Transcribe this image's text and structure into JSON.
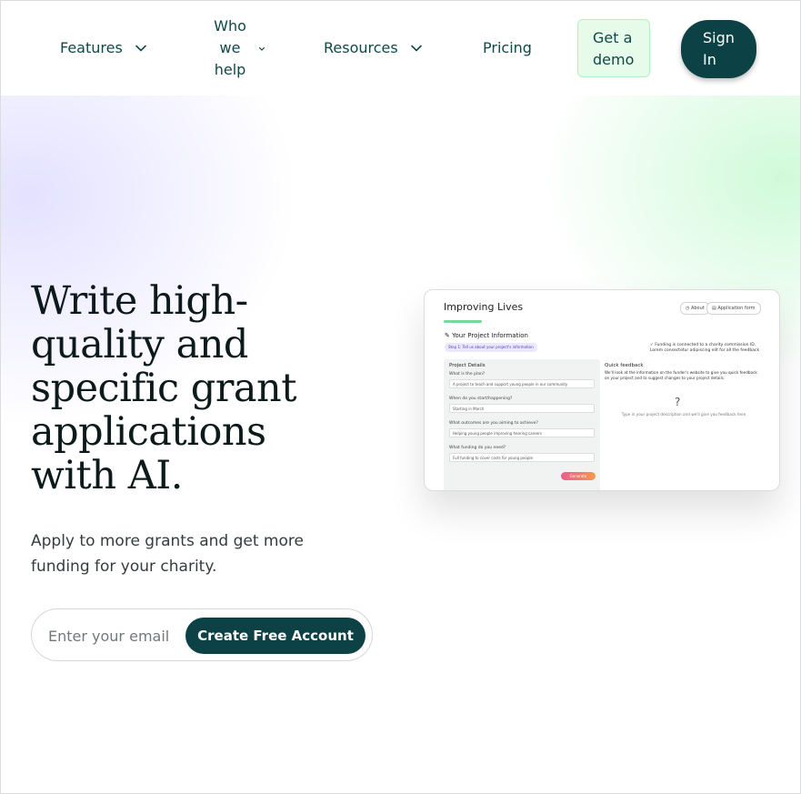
{
  "nav": {
    "features": "Features",
    "who_we_help": [
      "Who",
      "we",
      "help"
    ],
    "resources": "Resources",
    "pricing": "Pricing",
    "get_demo": [
      "Get a",
      "demo"
    ],
    "sign_in": [
      "Sign",
      "In"
    ]
  },
  "hero": {
    "headline": [
      "Write high-",
      "quality and",
      "specific grant",
      "applications",
      "with AI."
    ],
    "subheadline": [
      "Apply to more grants and get more",
      "funding for your charity."
    ],
    "email_placeholder": "Enter your email",
    "cta_label": "Create Free Account"
  },
  "preview": {
    "title": "Improving Lives",
    "chip_about": "About",
    "chip_form": "Application form",
    "section_title": "Your Project Information",
    "purple_tag": "Step 1: Tell us about your project's information",
    "check_text": "Funding is connected to a charity commission ID. Lorem consectetur adipiscing elit for all the feedback",
    "left_heading": "Project Details",
    "questions": [
      {
        "q": "What is the plan?",
        "a": "A project to teach and support young people in our community"
      },
      {
        "q": "When do you start/happening?",
        "a": "Starting in March"
      },
      {
        "q": "What outcomes are you aiming to achieve?",
        "a": "Helping young people improving hearing careers"
      },
      {
        "q": "What funding do you need?",
        "a": "Full funding to cover costs for young people"
      }
    ],
    "generate_label": "Generate",
    "right_heading": "Quick feedback",
    "feedback_text": "We'll look at the information on the funder's website to give you quick feedback on your project and to suggest changes to your project details.",
    "qmark": "?",
    "hint": "Type in your project description and we'll give you feedback here"
  },
  "colors": {
    "primary": "#0c4146",
    "demo_bg": "#e6fbea",
    "accent_green": "#7cd79a",
    "headline": "#0c1a1c"
  }
}
